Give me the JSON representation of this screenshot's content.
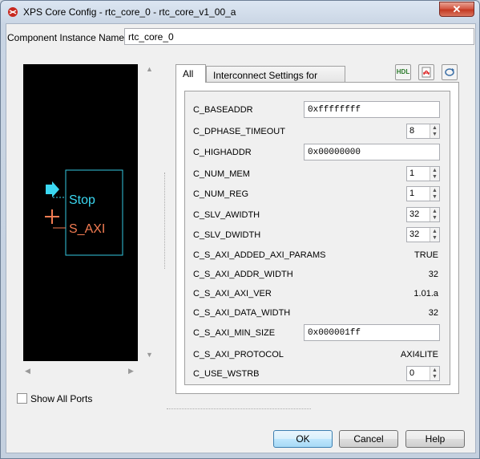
{
  "window": {
    "title": "XPS Core Config - rtc_core_0 - rtc_core_v1_00_a",
    "close_glyph": "✕"
  },
  "instance": {
    "label": "Component Instance Name",
    "value": "rtc_core_0"
  },
  "preview": {
    "ports": [
      {
        "name": "Stop",
        "color": "#3bd8f2"
      },
      {
        "name": "S_AXI",
        "color": "#f47c52"
      }
    ],
    "block_border_color": "#34c7e0"
  },
  "show_all_ports": {
    "label": "Show All Ports",
    "checked": false
  },
  "tabs": [
    {
      "label": "All",
      "active": true
    },
    {
      "label": "Interconnect Settings for BUSIF",
      "active": false
    }
  ],
  "toolbar": {
    "hdl_label": "HDL",
    "pdf_icon": "pdf-icon",
    "refresh_icon": "refresh-icon"
  },
  "params": [
    {
      "name": "C_BASEADDR",
      "kind": "text",
      "value": "0xffffffff"
    },
    {
      "name": "C_DPHASE_TIMEOUT",
      "kind": "spin",
      "value": "8"
    },
    {
      "name": "C_HIGHADDR",
      "kind": "text",
      "value": "0x00000000"
    },
    {
      "name": "C_NUM_MEM",
      "kind": "spin",
      "value": "1"
    },
    {
      "name": "C_NUM_REG",
      "kind": "spin",
      "value": "1"
    },
    {
      "name": "C_SLV_AWIDTH",
      "kind": "spin",
      "value": "32"
    },
    {
      "name": "C_SLV_DWIDTH",
      "kind": "spin",
      "value": "32"
    },
    {
      "name": "C_S_AXI_ADDED_AXI_PARAMS",
      "kind": "static",
      "value": "TRUE"
    },
    {
      "name": "C_S_AXI_ADDR_WIDTH",
      "kind": "static",
      "value": "32"
    },
    {
      "name": "C_S_AXI_AXI_VER",
      "kind": "static",
      "value": "1.01.a"
    },
    {
      "name": "C_S_AXI_DATA_WIDTH",
      "kind": "static",
      "value": "32"
    },
    {
      "name": "C_S_AXI_MIN_SIZE",
      "kind": "text",
      "value": "0x000001ff"
    },
    {
      "name": "C_S_AXI_PROTOCOL",
      "kind": "static",
      "value": "AXI4LITE"
    },
    {
      "name": "C_USE_WSTRB",
      "kind": "spin",
      "value": "0"
    }
  ],
  "buttons": {
    "ok": "OK",
    "cancel": "Cancel",
    "help": "Help"
  }
}
